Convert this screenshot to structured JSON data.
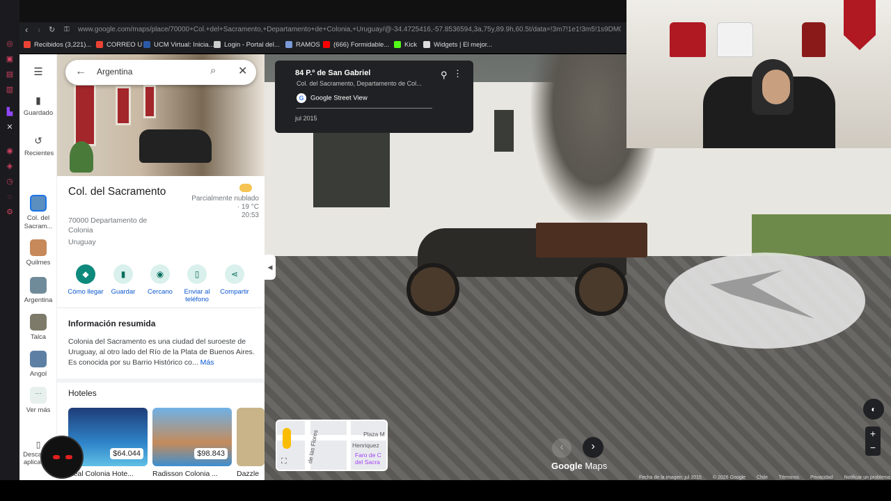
{
  "browser": {
    "url": "www.google.com/maps/place/70000+Col.+del+Sacramento,+Departamento+de+Colonia,+Uruguay/@-34.4725416,-57.8536594,3a,75y,89.9h,60.5t/data=!3m7!1e1!3m5!1s9DM0_hQrfws5vR8T",
    "bookmarks": [
      {
        "label": "Recibidos (3,221)...",
        "color": "#ea4335"
      },
      {
        "label": "CORREO U",
        "color": "#ea4335"
      },
      {
        "label": "UCM Virtual: Inicia...",
        "color": "#2b5aa8"
      },
      {
        "label": "Login - Portal del...",
        "color": "#cccccc"
      },
      {
        "label": "RAMOS",
        "color": "#7a9ad8"
      },
      {
        "label": "(666) Formidable...",
        "color": "#ff0000"
      },
      {
        "label": "Kick",
        "color": "#53fc18"
      },
      {
        "label": "Widgets | El mejor...",
        "color": "#dddddd"
      }
    ]
  },
  "rail": {
    "saved": "Guardado",
    "recent": "Recientes",
    "items": [
      {
        "label": "Col. del Sacram...",
        "color": "#5b8fbf"
      },
      {
        "label": "Quilmes",
        "color": "#c7885a"
      },
      {
        "label": "Argentina",
        "color": "#6f8b9a"
      },
      {
        "label": "Talca",
        "color": "#7d7a6a"
      },
      {
        "label": "Angol",
        "color": "#5c7fa3"
      }
    ],
    "more": "Ver más",
    "download": "Descargar aplicación"
  },
  "search": {
    "value": "Argentina"
  },
  "place": {
    "title": "Col. del Sacramento",
    "address": "70000 Departamento de Colonia",
    "country": "Uruguay",
    "weather_desc": "Parcialmente nublado · 19 °C",
    "weather_time": "20:53"
  },
  "actions": [
    {
      "label": "Cómo llegar",
      "icon": "directions-icon",
      "glyph": "◆"
    },
    {
      "label": "Guardar",
      "icon": "bookmark-icon",
      "glyph": "▮"
    },
    {
      "label": "Cercano",
      "icon": "nearby-icon",
      "glyph": "◉"
    },
    {
      "label": "Enviar al teléfono",
      "icon": "phone-icon",
      "glyph": "▯"
    },
    {
      "label": "Compartir",
      "icon": "share-icon",
      "glyph": "⋖"
    }
  ],
  "summary": {
    "heading": "Información resumida",
    "text": "Colonia del Sacramento es una ciudad del suroeste de Uruguay, al otro lado del Río de la Plata de Buenos Aires. Es conocida por su Barrio Histórico co...",
    "more": "Más"
  },
  "hotels": {
    "heading": "Hoteles",
    "items": [
      {
        "name": "Real Colonia Hote...",
        "price": "$64.044",
        "color": "#2f84c9"
      },
      {
        "name": "Radisson Colonia ...",
        "price": "$98.843",
        "color": "#3d8fd0"
      },
      {
        "name": "Dazzle",
        "price": "",
        "color": "#c9b48a"
      }
    ]
  },
  "streetview": {
    "title": "84 P.º de San Gabriel",
    "subtitle": "Col. del Sacramento, Departamento de Col...",
    "provider": "Google Street View",
    "date": "jul 2015"
  },
  "minimap": {
    "label1": "Plaza M",
    "label2": "Henriquez",
    "label3": "Faro de C del Sacra",
    "label4": "de las Flores"
  },
  "brand": {
    "google": "Google",
    "maps": "Maps"
  },
  "footer": {
    "capture": "Fecha de la imagen: jul 2015",
    "copyright": "© 2026 Google",
    "country": "Chile",
    "terms": "Términos",
    "privacy": "Privacidad",
    "report": "Notificar un problema"
  }
}
